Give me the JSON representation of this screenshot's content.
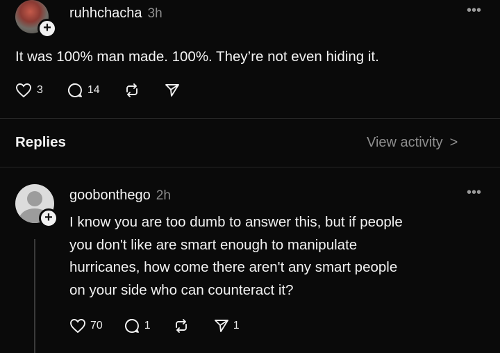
{
  "post": {
    "username": "ruhhchacha",
    "time": "3h",
    "text": "It was 100% man made. 100%. They’re not even hiding it.",
    "likes": "3",
    "replies": "14",
    "more_icon": "ellipsis-icon"
  },
  "replies_header": {
    "label": "Replies",
    "view_activity": "View activity",
    "chevron": ">"
  },
  "reply": {
    "username": "goobonthego",
    "time": "2h",
    "lines": [
      "I know you are too dumb to answer this, but if people",
      "you don't like are smart enough to manipulate",
      "hurricanes, how come there aren't any smart people",
      "on your side who can counteract it?"
    ],
    "likes": "70",
    "replies": "1",
    "shares": "1"
  },
  "colors": {
    "background": "#0a0a0a",
    "text": "#f2f2f2",
    "muted": "#8e8e8e",
    "divider": "#262626"
  }
}
